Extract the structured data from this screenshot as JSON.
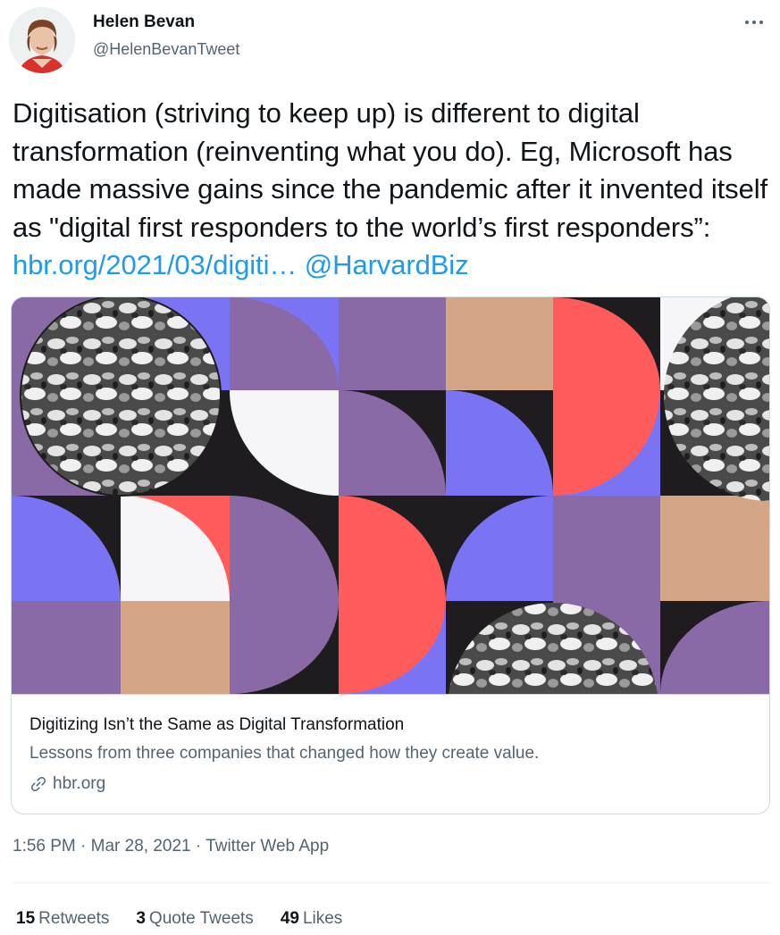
{
  "author": {
    "name": "Helen Bevan",
    "handle": "@HelenBevanTweet"
  },
  "tweet": {
    "text": "Digitisation (striving to keep up) is different to digital transformation (reinventing what you do). Eg, Microsoft has made massive gains since the pandemic after it invented itself as \"digital first responders to the world’s first responders”:",
    "link": "hbr.org/2021/03/digiti…",
    "mention": "@HarvardBiz"
  },
  "card": {
    "title": "Digitizing Isn’t the Same as Digital Transformation",
    "description": "Lessons from three companies that changed how they create value.",
    "domain": "hbr.org"
  },
  "meta": {
    "time": "1:56 PM",
    "separator": "·",
    "date": "Mar 28, 2021",
    "app": "Twitter Web App"
  },
  "stats": {
    "retweets_count": "15",
    "retweets_label": "Retweets",
    "quotes_count": "3",
    "quotes_label": "Quote Tweets",
    "likes_count": "49",
    "likes_label": "Likes"
  },
  "colors": {
    "link": "#1d9bf0",
    "secondary_text": "#536471",
    "pattern_purple": "#8a6aa6",
    "pattern_blue": "#7a74f5",
    "pattern_red": "#ff5b5b",
    "pattern_tan": "#d3a584",
    "pattern_black": "#1e1c1f",
    "pattern_white": "#f6f5f8"
  }
}
